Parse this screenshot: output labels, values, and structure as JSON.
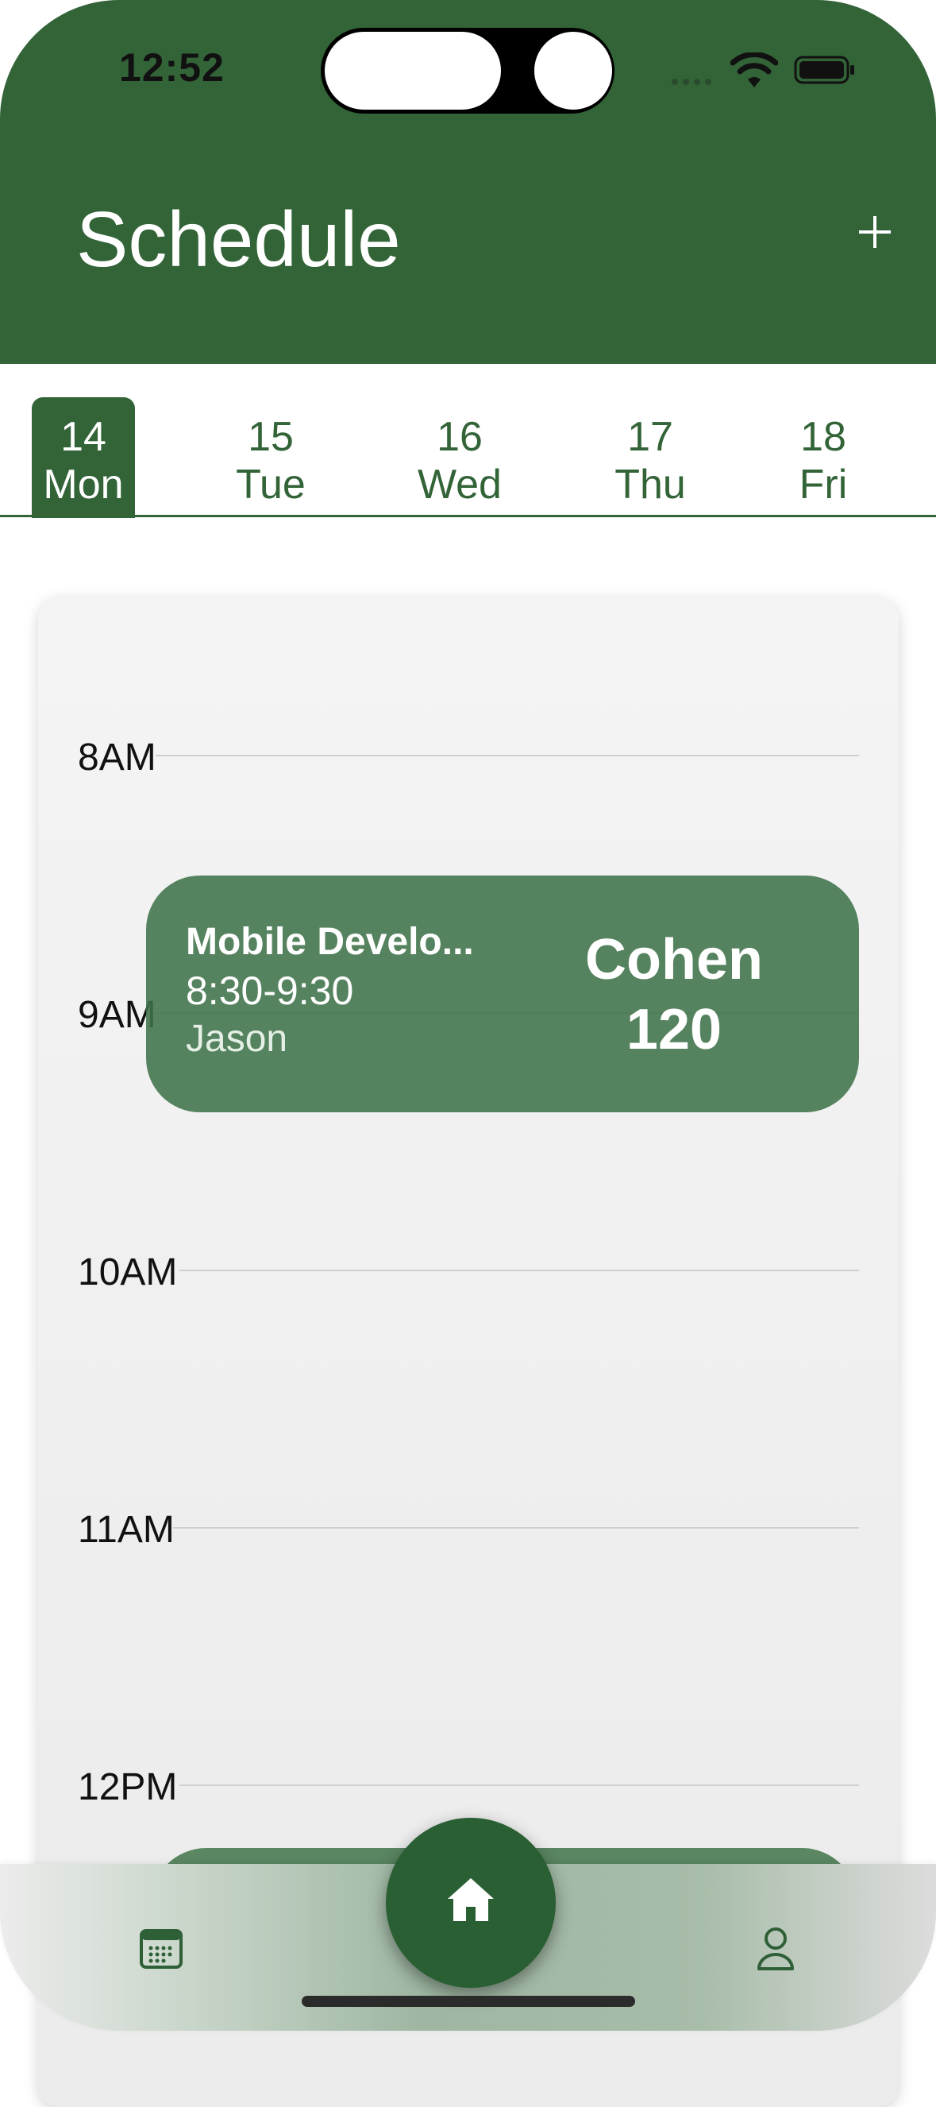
{
  "status_bar": {
    "time": "12:52"
  },
  "header": {
    "title": "Schedule",
    "add_label": "+"
  },
  "days": [
    {
      "number": "14",
      "weekday": "Mon",
      "selected": true
    },
    {
      "number": "15",
      "weekday": "Tue",
      "selected": false
    },
    {
      "number": "16",
      "weekday": "Wed",
      "selected": false
    },
    {
      "number": "17",
      "weekday": "Thu",
      "selected": false
    },
    {
      "number": "18",
      "weekday": "Fri",
      "selected": false
    }
  ],
  "timeline": {
    "hours": [
      "8AM",
      "9AM",
      "10AM",
      "11AM",
      "12PM"
    ]
  },
  "events": [
    {
      "title": "Mobile Develo...",
      "time": "8:30-9:30",
      "teacher": "Jason",
      "room_building": "Cohen",
      "room_number": "120"
    }
  ],
  "tabbar": {
    "left_icon": "calendar-icon",
    "center_icon": "home-icon",
    "right_icon": "profile-icon"
  },
  "colors": {
    "primary": "#336438",
    "event": "#40734A",
    "home_button": "#2A5F33"
  }
}
